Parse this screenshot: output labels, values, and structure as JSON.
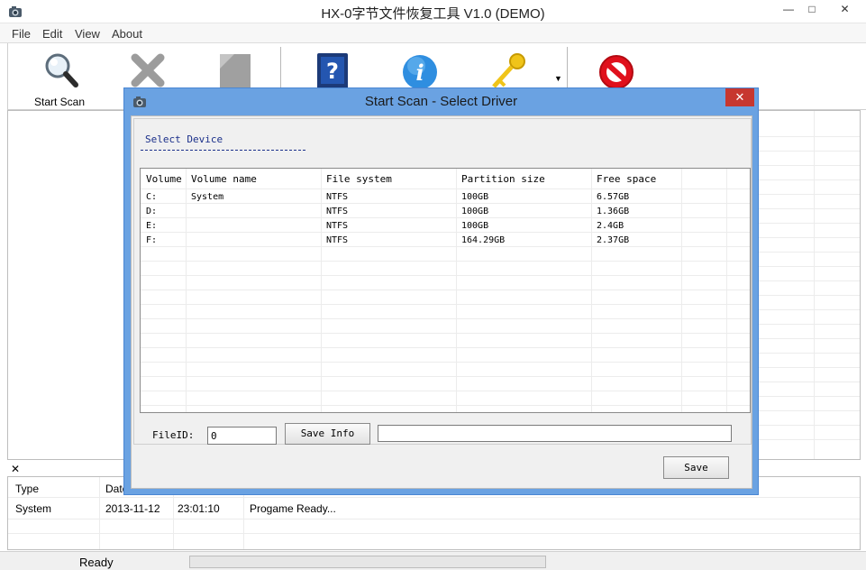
{
  "window": {
    "title": "HX-0字节文件恢复工具 V1.0 (DEMO)"
  },
  "menu": [
    "File",
    "Edit",
    "View",
    "About"
  ],
  "toolbar": {
    "start_scan_label": "Start Scan"
  },
  "dialog": {
    "title": "Start Scan - Select Driver",
    "section_label": "Select Device",
    "columns": [
      "Volume",
      "Volume name",
      "File system",
      "Partition size",
      "Free space"
    ],
    "rows": [
      [
        "C:",
        "System",
        "NTFS",
        "100GB",
        "6.57GB"
      ],
      [
        "D:",
        "",
        "NTFS",
        "100GB",
        "1.36GB"
      ],
      [
        "E:",
        "",
        "NTFS",
        "100GB",
        "2.4GB"
      ],
      [
        "F:",
        "",
        "NTFS",
        "164.29GB",
        "2.37GB"
      ]
    ],
    "fileid_label": "FileID:",
    "fileid_value": "0",
    "save_info_label": "Save Info",
    "save_label": "Save"
  },
  "log": {
    "columns": [
      "Type",
      "Date"
    ],
    "rows": [
      [
        "System",
        "2013-11-12",
        "23:01:10",
        "Progame Ready..."
      ]
    ]
  },
  "status": {
    "text": "Ready",
    "progress": 0
  },
  "colors": {
    "dialog_border": "#6aa2e2",
    "close_button": "#c7372f",
    "section_text": "#1a2f8a"
  }
}
